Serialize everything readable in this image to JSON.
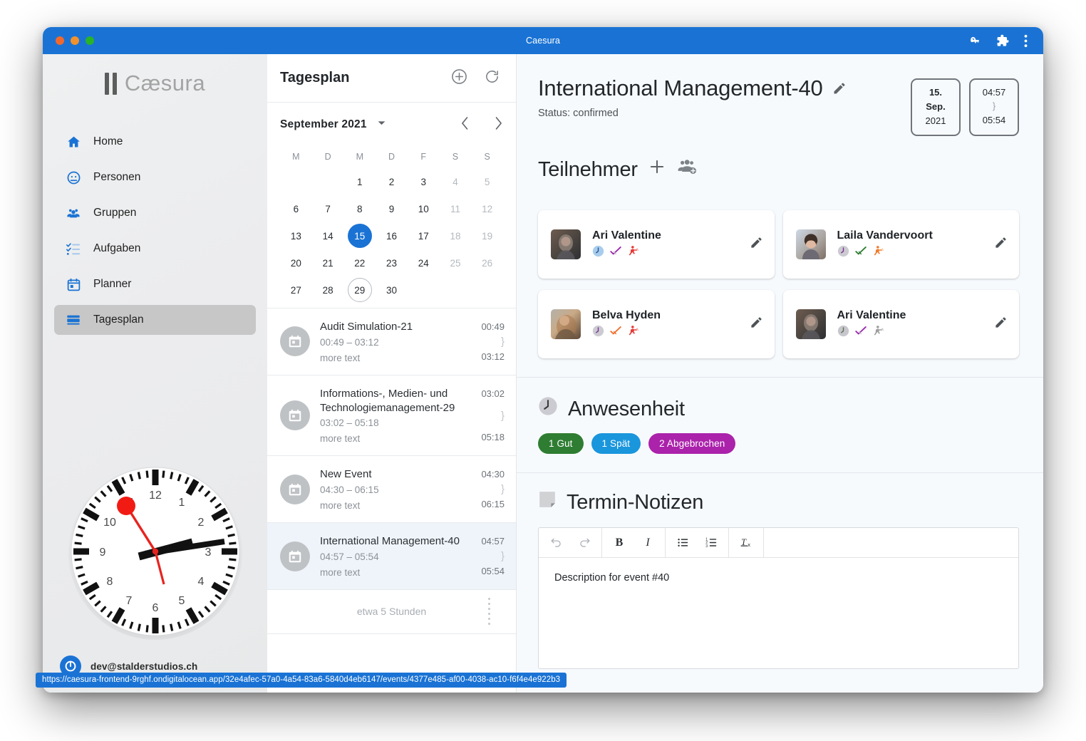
{
  "window": {
    "title": "Caesura",
    "controls": [
      "close",
      "minimize",
      "maximize"
    ],
    "right_icons": [
      "key-icon",
      "extension-puzzle-icon",
      "kebab-menu-icon"
    ],
    "accent": "#1a73d4"
  },
  "sidebar": {
    "brand": "Cæsura",
    "items": [
      {
        "label": "Home",
        "icon": "home-icon",
        "active": false
      },
      {
        "label": "Personen",
        "icon": "person-icon",
        "active": false
      },
      {
        "label": "Gruppen",
        "icon": "groups-icon",
        "active": false
      },
      {
        "label": "Aufgaben",
        "icon": "checklist-icon",
        "active": false
      },
      {
        "label": "Planner",
        "icon": "calendar-icon",
        "active": false
      },
      {
        "label": "Tagesplan",
        "icon": "day-plan-icon",
        "active": true
      }
    ],
    "clock": {
      "hour": 2,
      "minute": 14,
      "second": 56,
      "style": "swiss-railway"
    },
    "user_email": "dev@stalderstudios.ch"
  },
  "mid_panel": {
    "title": "Tagesplan",
    "actions": [
      "add-circle-icon",
      "refresh-icon"
    ],
    "calendar": {
      "month_label": "September 2021",
      "dow": [
        "M",
        "D",
        "M",
        "D",
        "F",
        "S",
        "S"
      ],
      "weeks": [
        [
          {
            "d": "",
            "muted": true
          },
          {
            "d": "",
            "muted": true
          },
          {
            "d": "1"
          },
          {
            "d": "2"
          },
          {
            "d": "3"
          },
          {
            "d": "4",
            "muted": true
          },
          {
            "d": "5",
            "muted": true
          }
        ],
        [
          {
            "d": "6"
          },
          {
            "d": "7"
          },
          {
            "d": "8"
          },
          {
            "d": "9"
          },
          {
            "d": "10"
          },
          {
            "d": "11",
            "muted": true
          },
          {
            "d": "12",
            "muted": true
          }
        ],
        [
          {
            "d": "13"
          },
          {
            "d": "14"
          },
          {
            "d": "15",
            "selected": true
          },
          {
            "d": "16"
          },
          {
            "d": "17"
          },
          {
            "d": "18",
            "muted": true
          },
          {
            "d": "19",
            "muted": true
          }
        ],
        [
          {
            "d": "20"
          },
          {
            "d": "21"
          },
          {
            "d": "22"
          },
          {
            "d": "23"
          },
          {
            "d": "24"
          },
          {
            "d": "25",
            "muted": true
          },
          {
            "d": "26",
            "muted": true
          }
        ],
        [
          {
            "d": "27"
          },
          {
            "d": "28"
          },
          {
            "d": "29",
            "today": true
          },
          {
            "d": "30"
          },
          {
            "d": ""
          },
          {
            "d": ""
          },
          {
            "d": ""
          }
        ]
      ],
      "prev_label": "previous month",
      "next_label": "next month"
    },
    "events": [
      {
        "title": "Audit Simulation-21",
        "time_range": "00:49 – 03:12",
        "more": "more text",
        "start": "00:49",
        "end": "03:12",
        "active": false
      },
      {
        "title": "Informations-, Medien- und Technologiemanagement-29",
        "time_range": "03:02 – 05:18",
        "more": "more text",
        "start": "03:02",
        "end": "05:18",
        "active": false
      },
      {
        "title": "New Event",
        "time_range": "04:30 – 06:15",
        "more": "more text",
        "start": "04:30",
        "end": "06:15",
        "active": false
      },
      {
        "title": "International Management-40",
        "time_range": "04:57 – 05:54",
        "more": "more text",
        "start": "04:57",
        "end": "05:54",
        "active": true
      }
    ],
    "footer_summary": "etwa 5 Stunden"
  },
  "main": {
    "title": "International Management-40",
    "edit_icon": "pencil-icon",
    "status": "Status: confirmed",
    "date_box": {
      "day": "15.",
      "month": "Sep.",
      "year": "2021"
    },
    "time_box": {
      "start": "04:57",
      "end": "05:54"
    },
    "participants_heading": "Teilnehmer",
    "participants_actions": [
      "plus-icon",
      "group-add-icon"
    ],
    "participants": [
      {
        "name": "Ari Valentine",
        "clock_color": "#a8cdec",
        "check_color": "#9c27b0",
        "runner_color": "#e53935",
        "avatar_from": "#5d4f46",
        "avatar_to": "#3b3b41"
      },
      {
        "name": "Laila Vandervoort",
        "clock_color": "#c9c9cf",
        "check_color": "#2e7d32",
        "runner_color": "#f07c2e",
        "avatar_from": "#cfd8e3",
        "avatar_to": "#8a7a72"
      },
      {
        "name": "Belva Hyden",
        "clock_color": "#c9c9cf",
        "check_color": "#f0702e",
        "runner_color": "#e53935",
        "avatar_from": "#c9b49a",
        "avatar_to": "#6b5542"
      },
      {
        "name": "Ari Valentine",
        "clock_color": "#c9c9cf",
        "check_color": "#9c27b0",
        "runner_color": "#9e9e9e",
        "avatar_from": "#5d4f46",
        "avatar_to": "#3b3b41"
      }
    ],
    "attendance_heading": "Anwesenheit",
    "attendance_icon": "clock-icon",
    "attendance_badges": [
      {
        "label": "1 Gut",
        "color": "#2e7d32"
      },
      {
        "label": "1 Spät",
        "color": "#1a96dc"
      },
      {
        "label": "2 Abgebrochen",
        "color": "#ab22ab"
      }
    ],
    "notes_heading": "Termin-Notizen",
    "notes_icon": "note-icon",
    "editor": {
      "buttons": [
        {
          "name": "undo",
          "glyph": "↶",
          "disabled": true
        },
        {
          "name": "redo",
          "glyph": "↷",
          "disabled": true
        },
        {
          "name": "bold",
          "glyph": "B",
          "disabled": false
        },
        {
          "name": "italic",
          "glyph": "I",
          "disabled": false
        },
        {
          "name": "bullet-list",
          "glyph": "•≡",
          "disabled": false
        },
        {
          "name": "numbered-list",
          "glyph": "1≡",
          "disabled": false
        },
        {
          "name": "clear-format",
          "glyph": "Tx",
          "disabled": false
        }
      ],
      "content": "Description for event #40"
    }
  },
  "status_bar": {
    "url": "https://caesura-frontend-9rghf.ondigitalocean.app/32e4afec-57a0-4a54-83a6-5840d4eb6147/events/4377e485-af00-4038-ac10-f6f4e4e922b3"
  }
}
